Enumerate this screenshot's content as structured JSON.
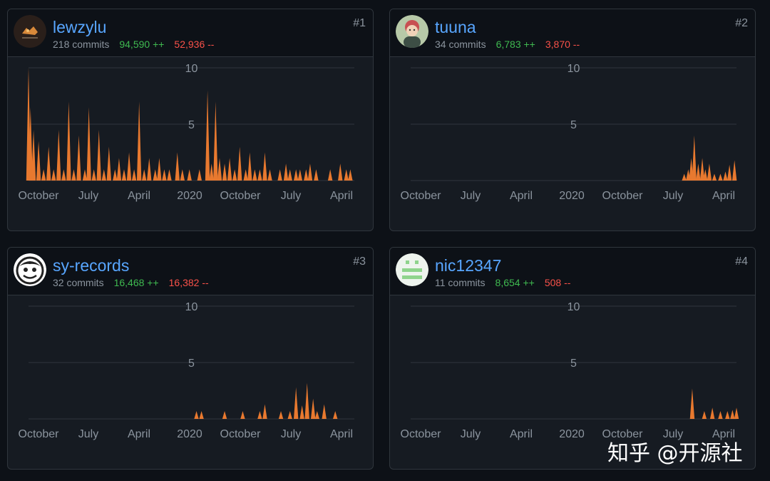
{
  "colors": {
    "area": "#e8792f",
    "grid": "#30363d",
    "tick": "#8b949e",
    "link": "#58a6ff",
    "additions": "#3fb950",
    "deletions": "#f85149"
  },
  "watermark": "知乎 @开源社",
  "contributors": [
    {
      "username": "lewzylu",
      "commits": "218 commits",
      "additions": "94,590 ++",
      "deletions": "52,936 --",
      "rank": "#1",
      "avatar_icon": "dark-logo-avatar-icon"
    },
    {
      "username": "tuuna",
      "commits": "34 commits",
      "additions": "6,783 ++",
      "deletions": "3,870 --",
      "rank": "#2",
      "avatar_icon": "baby-photo-avatar-icon"
    },
    {
      "username": "sy-records",
      "commits": "32 commits",
      "additions": "16,468 ++",
      "deletions": "16,382 --",
      "rank": "#3",
      "avatar_icon": "anime-face-avatar-icon"
    },
    {
      "username": "nic12347",
      "commits": "11 commits",
      "additions": "8,654 ++",
      "deletions": "508 --",
      "rank": "#4",
      "avatar_icon": "green-identicon-avatar-icon"
    }
  ],
  "chart_data": [
    {
      "type": "area",
      "series": [
        {
          "values": [
            [
              0.0,
              10.0
            ],
            [
              0.2,
              6.5
            ],
            [
              0.5,
              4.5
            ],
            [
              1.0,
              3.5
            ],
            [
              1.5,
              1.0
            ],
            [
              2.0,
              3.0
            ],
            [
              2.5,
              1.0
            ],
            [
              3.0,
              4.5
            ],
            [
              3.5,
              1.0
            ],
            [
              4.0,
              7.0
            ],
            [
              4.5,
              1.0
            ],
            [
              5.0,
              4.0
            ],
            [
              5.6,
              1.0
            ],
            [
              6.0,
              6.5
            ],
            [
              6.5,
              1.0
            ],
            [
              7.0,
              4.5
            ],
            [
              7.5,
              1.0
            ],
            [
              8.0,
              3.0
            ],
            [
              8.6,
              1.0
            ],
            [
              9.0,
              2.0
            ],
            [
              9.5,
              1.0
            ],
            [
              10.0,
              2.5
            ],
            [
              10.5,
              1.0
            ],
            [
              11.0,
              7.0
            ],
            [
              11.5,
              1.0
            ],
            [
              12.0,
              2.0
            ],
            [
              12.6,
              1.0
            ],
            [
              13.0,
              2.0
            ],
            [
              13.5,
              1.0
            ],
            [
              14.0,
              1.0
            ],
            [
              14.8,
              2.5
            ],
            [
              15.3,
              1.0
            ],
            [
              16.0,
              1.0
            ],
            [
              17.0,
              1.0
            ],
            [
              17.8,
              8.0
            ],
            [
              18.2,
              1.5
            ],
            [
              18.6,
              7.0
            ],
            [
              19.0,
              2.0
            ],
            [
              19.5,
              1.5
            ],
            [
              20.0,
              2.0
            ],
            [
              20.5,
              1.0
            ],
            [
              21.0,
              3.0
            ],
            [
              21.6,
              1.0
            ],
            [
              22.0,
              2.5
            ],
            [
              22.5,
              1.0
            ],
            [
              23.0,
              1.0
            ],
            [
              23.5,
              2.5
            ],
            [
              24.0,
              1.0
            ],
            [
              25.0,
              1.0
            ],
            [
              25.6,
              1.5
            ],
            [
              26.0,
              1.0
            ],
            [
              26.6,
              1.0
            ],
            [
              27.0,
              1.0
            ],
            [
              27.6,
              1.0
            ],
            [
              28.0,
              1.5
            ],
            [
              28.6,
              1.0
            ],
            [
              30.0,
              1.0
            ],
            [
              31.0,
              1.5
            ],
            [
              31.6,
              1.0
            ],
            [
              32.0,
              1.0
            ]
          ]
        }
      ],
      "x_ticks": [
        "October",
        "July",
        "April",
        "2020",
        "October",
        "July",
        "April"
      ],
      "y_ticks": [
        5,
        10
      ],
      "ylim": [
        0,
        10
      ],
      "grid": true
    },
    {
      "type": "area",
      "series": [
        {
          "values": [
            [
              27.2,
              0.6
            ],
            [
              27.6,
              1.0
            ],
            [
              27.9,
              2.0
            ],
            [
              28.2,
              4.0
            ],
            [
              28.6,
              1.5
            ],
            [
              29.0,
              2.0
            ],
            [
              29.3,
              1.0
            ],
            [
              29.7,
              1.5
            ],
            [
              30.2,
              0.6
            ],
            [
              30.8,
              0.6
            ],
            [
              31.3,
              0.8
            ],
            [
              31.7,
              1.4
            ],
            [
              32.2,
              1.8
            ]
          ]
        }
      ],
      "x_ticks": [
        "October",
        "July",
        "April",
        "2020",
        "October",
        "July",
        "April"
      ],
      "y_ticks": [
        5,
        10
      ],
      "ylim": [
        0,
        10
      ],
      "grid": true
    },
    {
      "type": "area",
      "series": [
        {
          "values": [
            [
              16.7,
              0.7
            ],
            [
              17.2,
              0.7
            ],
            [
              19.5,
              0.7
            ],
            [
              21.3,
              0.7
            ],
            [
              23.0,
              0.7
            ],
            [
              23.5,
              1.3
            ],
            [
              25.1,
              0.7
            ],
            [
              26.0,
              0.7
            ],
            [
              26.6,
              2.8
            ],
            [
              27.2,
              1.2
            ],
            [
              27.7,
              3.2
            ],
            [
              28.3,
              1.8
            ],
            [
              28.7,
              0.7
            ],
            [
              29.4,
              1.3
            ],
            [
              30.5,
              0.7
            ]
          ]
        }
      ],
      "x_ticks": [
        "October",
        "July",
        "April",
        "2020",
        "October",
        "July",
        "April"
      ],
      "y_ticks": [
        5,
        10
      ],
      "ylim": [
        0,
        10
      ],
      "grid": true
    },
    {
      "type": "area",
      "series": [
        {
          "values": [
            [
              28.0,
              2.7
            ],
            [
              29.2,
              0.7
            ],
            [
              30.0,
              1.0
            ],
            [
              30.8,
              0.7
            ],
            [
              31.5,
              0.7
            ],
            [
              32.0,
              0.8
            ],
            [
              32.4,
              1.0
            ]
          ]
        }
      ],
      "x_ticks": [
        "October",
        "July",
        "April",
        "2020",
        "October",
        "July",
        "April"
      ],
      "y_ticks": [
        5,
        10
      ],
      "ylim": [
        0,
        10
      ],
      "grid": true
    }
  ]
}
